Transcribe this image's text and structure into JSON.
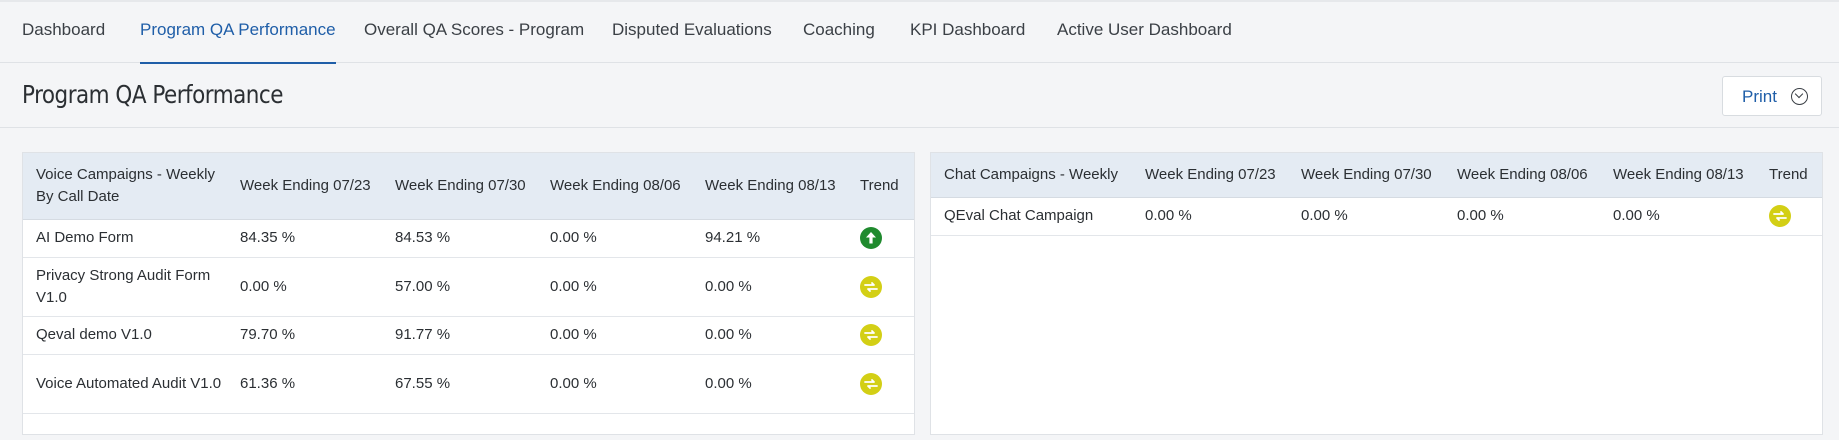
{
  "nav": {
    "tabs": [
      {
        "label": "Dashboard"
      },
      {
        "label": "Program QA Performance"
      },
      {
        "label": "Overall QA Scores - Program"
      },
      {
        "label": "Disputed Evaluations"
      },
      {
        "label": "Coaching"
      },
      {
        "label": "KPI Dashboard"
      },
      {
        "label": "Active User Dashboard"
      }
    ]
  },
  "header": {
    "title": "Program QA Performance",
    "print_label": "Print"
  },
  "colors": {
    "accent": "#1f5ea8",
    "trend_up": "#1f8a2e",
    "trend_flat": "#d3cf15",
    "table_header_bg": "#e4ebf3"
  },
  "voice": {
    "columns": [
      "Voice Campaigns - Weekly By Call Date",
      "Week Ending 07/23",
      "Week Ending 07/30",
      "Week Ending 08/06",
      "Week Ending 08/13",
      "Trend"
    ],
    "rows": [
      {
        "name": "AI Demo Form",
        "w1": "84.35 %",
        "w2": "84.53 %",
        "w3": "0.00 %",
        "w4": "94.21 %",
        "trend": "arrow-up-icon"
      },
      {
        "name": "Privacy Strong Audit Form V1.0",
        "w1": "0.00 %",
        "w2": "57.00 %",
        "w3": "0.00 %",
        "w4": "0.00 %",
        "trend": "arrows-swap-icon"
      },
      {
        "name": "Qeval demo V1.0",
        "w1": "79.70 %",
        "w2": "91.77 %",
        "w3": "0.00 %",
        "w4": "0.00 %",
        "trend": "arrows-swap-icon"
      },
      {
        "name": "Voice Automated Audit V1.0",
        "w1": "61.36 %",
        "w2": "67.55 %",
        "w3": "0.00 %",
        "w4": "0.00 %",
        "trend": "arrows-swap-icon"
      }
    ]
  },
  "chat": {
    "columns": [
      "Chat Campaigns - Weekly",
      "Week Ending 07/23",
      "Week Ending 07/30",
      "Week Ending 08/06",
      "Week Ending 08/13",
      "Trend"
    ],
    "rows": [
      {
        "name": "QEval Chat Campaign",
        "w1": "0.00 %",
        "w2": "0.00 %",
        "w3": "0.00 %",
        "w4": "0.00 %",
        "trend": "arrows-swap-icon"
      }
    ]
  }
}
